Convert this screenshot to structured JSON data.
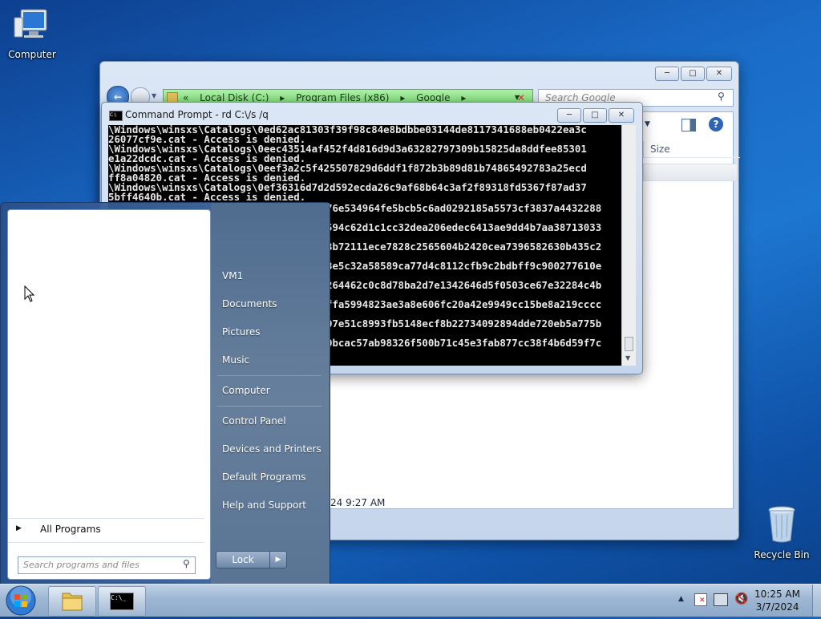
{
  "desktop": {
    "computer_label": "Computer",
    "recycle_label": "Recycle Bin"
  },
  "explorer": {
    "breadcrumb": [
      "«",
      "Local Disk (C:)",
      "▸",
      "Program Files (x86)",
      "▸",
      "Google",
      "▸"
    ],
    "search_placeholder": "Search Google",
    "column_size": "Size",
    "date_fragment": "24 9:27 AM"
  },
  "cmd": {
    "title": "Command Prompt - rd  C:\\/s /q",
    "lines": [
      "\\Windows\\winsxs\\Catalogs\\0ed62ac81303f39f98c84e8bdbbe03144de8117341688eb0422ea3c",
      "26077cf9e.cat - Access is denied.",
      "\\Windows\\winsxs\\Catalogs\\0eec43514af452f4d816d9d3a63282797309b15825da8ddfee85301",
      "e1a22dcdc.cat - Access is denied.",
      "\\Windows\\winsxs\\Catalogs\\0eef3a2c5f425507829d6ddf1f872b3b89d81b74865492783a25ecd",
      "ff8a04820.cat - Access is denied.",
      "\\Windows\\winsxs\\Catalogs\\0ef36316d7d2d592ecda26c9af68b64c3af2f89318fd5367f87ad37",
      "5bff4640b.cat - Access is denied."
    ],
    "partial_lines": [
      "76e534964fe5bcb5c6ad0292185a5573cf3837a4432288",
      "594c62d1c1cc32dea206edec6413ae9dd4b7aa38713033",
      "8b72111ece7828c2565604b2420cea7396582630b435c2",
      "8e5c32a58589ca77d4c8112cfb9c2bdbff9c900277610e",
      "264462c0c8d78ba2d7e1342646d5f0503ce67e32284c4b",
      "ffa5994823ae3a8e606fc20a42e9949cc15be8a219cccc",
      "07e51c8993fb5148ecf8b22734092894dde720eb5a775b",
      "0bcac57ab98326f500b71c45e3fab877cc38f4b6d59f7c"
    ]
  },
  "start_menu": {
    "right_items": [
      "VM1",
      "Documents",
      "Pictures",
      "Music",
      "Computer",
      "Control Panel",
      "Devices and Printers",
      "Default Programs",
      "Help and Support"
    ],
    "all_programs": "All Programs",
    "search_placeholder": "Search programs and files",
    "lock_label": "Lock"
  },
  "taskbar": {
    "time": "10:25 AM",
    "date": "3/7/2024"
  },
  "colors": {
    "start_orb": "#2e7bd6",
    "cmd_bg": "#000000",
    "address_bar": "#8fe887"
  }
}
